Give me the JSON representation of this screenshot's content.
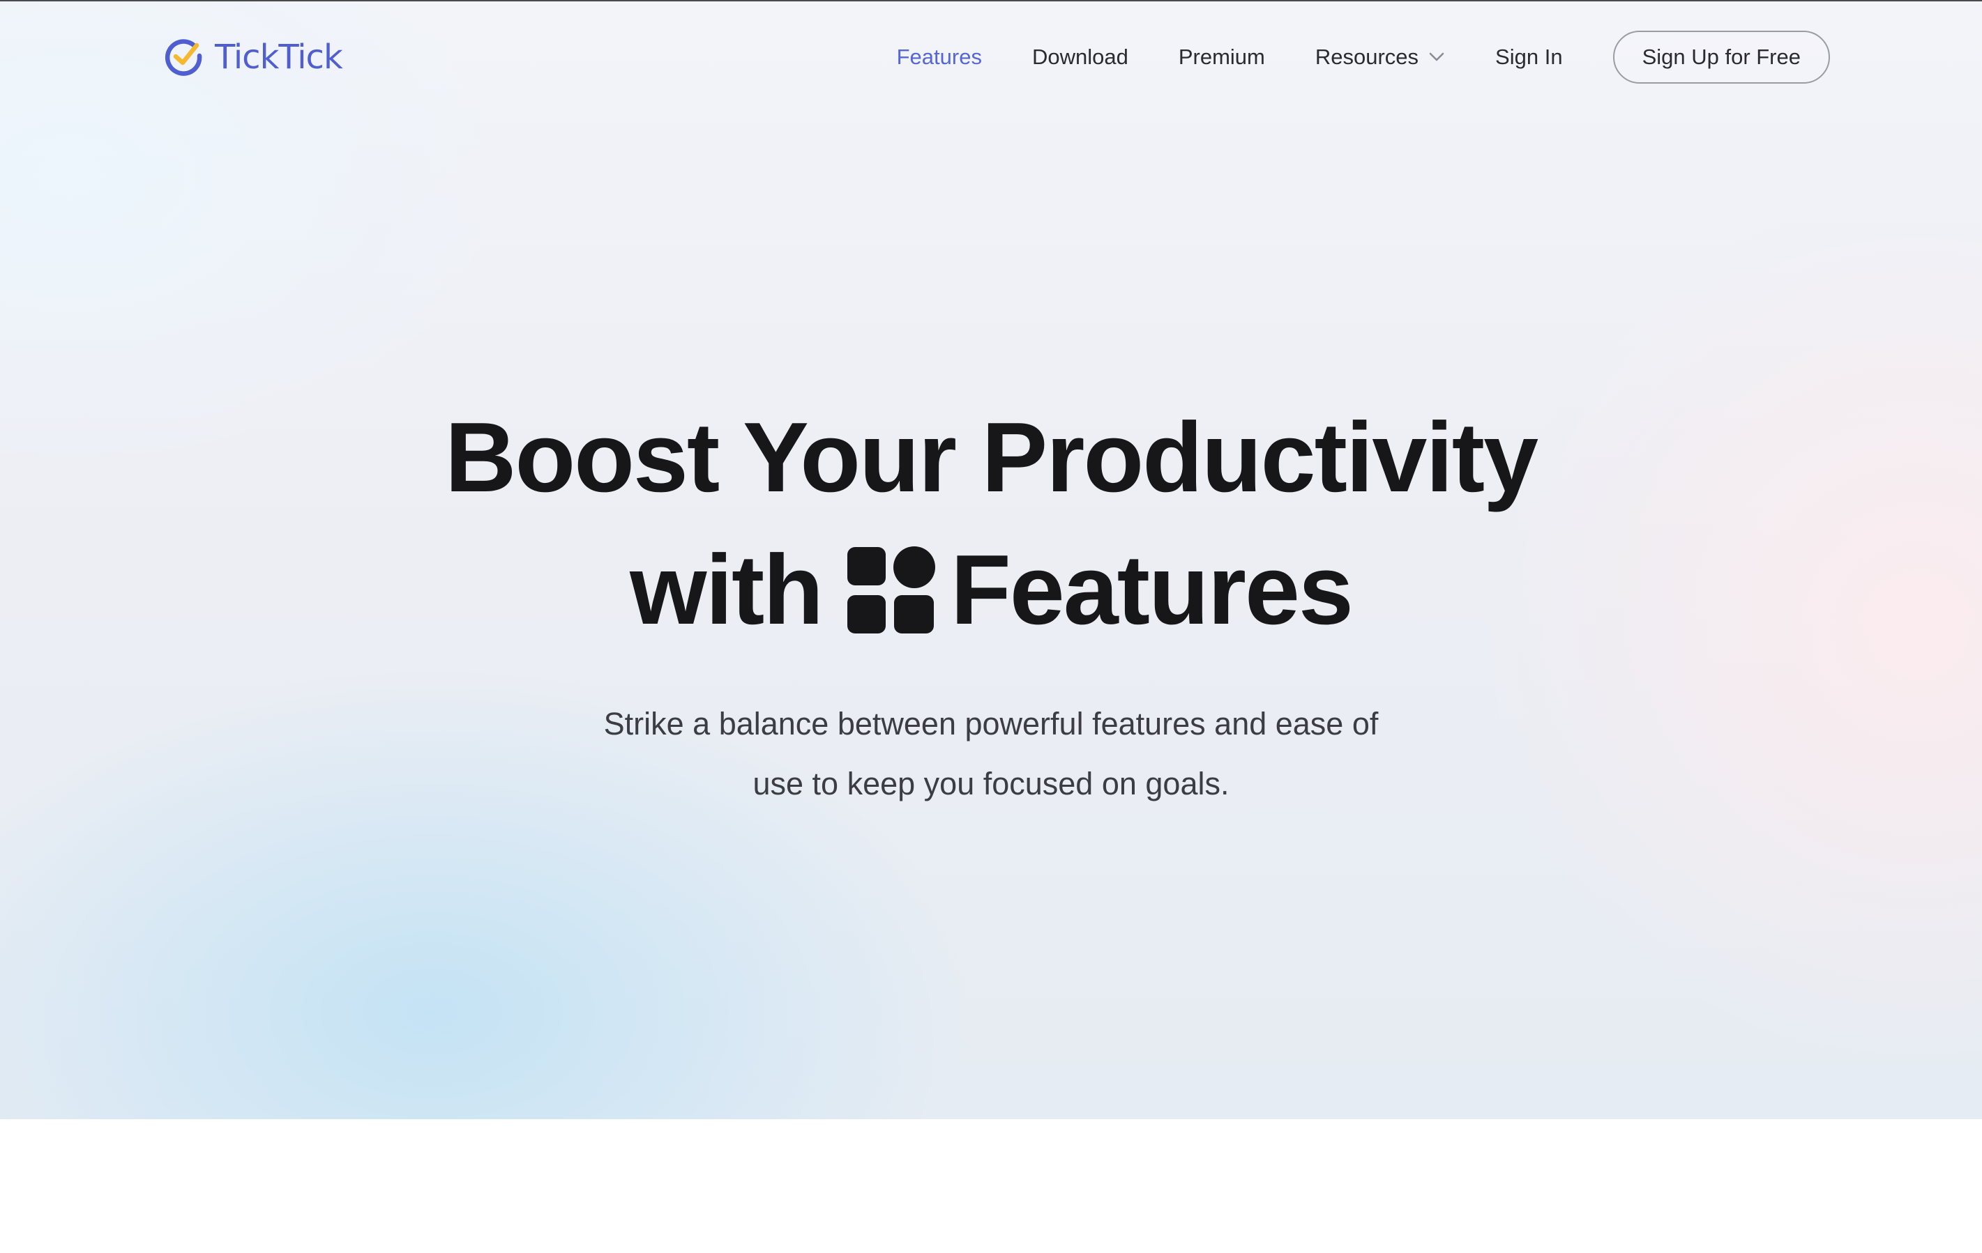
{
  "header": {
    "logo_text": "TickTick",
    "nav": {
      "features": "Features",
      "download": "Download",
      "premium": "Premium",
      "resources": "Resources",
      "sign_in": "Sign In",
      "sign_up": "Sign Up for Free"
    }
  },
  "hero": {
    "headline_line1": "Boost Your Productivity",
    "headline_with": "with",
    "headline_features": "Features",
    "subtitle_line1": "Strike a balance between powerful features and ease of",
    "subtitle_line2": "use to keep you focused on goals."
  },
  "colors": {
    "brand": "#4f5fd0",
    "accent_check": "#f5b82e",
    "active_nav": "#5567d6",
    "headline": "#17171a",
    "body_text": "#3c3d44"
  },
  "icons": {
    "logo": "ticktick-check-logo-icon",
    "headline_inline": "features-grid-icon",
    "resources_dropdown": "chevron-down-icon"
  }
}
